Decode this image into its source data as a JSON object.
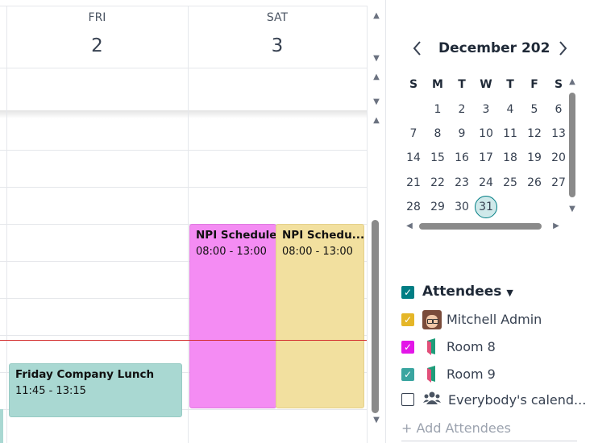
{
  "days": [
    {
      "dow": "FRI",
      "num": "2"
    },
    {
      "dow": "SAT",
      "num": "3"
    }
  ],
  "events": [
    {
      "title": "NPI Schedule S",
      "time": "08:00 - 13:00",
      "color": "#f48cf3"
    },
    {
      "title": "NPI Schedu...",
      "time": "08:00 - 13:00",
      "color": "#f2e09f"
    },
    {
      "title": "Friday Company Lunch",
      "time": "11:45 - 13:15",
      "color": "#a9d8d2"
    }
  ],
  "mini_calendar": {
    "month_label": "December 202",
    "prev_icon": "chevron-left-icon",
    "next_icon": "chevron-right-icon",
    "weekdays": [
      "S",
      "M",
      "T",
      "W",
      "T",
      "F",
      "S"
    ],
    "weeks": [
      [
        "",
        "1",
        "2",
        "3",
        "4",
        "5",
        "6"
      ],
      [
        "7",
        "8",
        "9",
        "10",
        "11",
        "12",
        "13"
      ],
      [
        "14",
        "15",
        "16",
        "17",
        "18",
        "19",
        "20"
      ],
      [
        "21",
        "22",
        "23",
        "24",
        "25",
        "26",
        "27"
      ],
      [
        "28",
        "29",
        "30",
        "31",
        "",
        "",
        ""
      ]
    ],
    "selected_day": "31"
  },
  "attendees": {
    "header": "Attendees",
    "items": [
      {
        "label": "Mitchell Admin",
        "color": "#e5b627",
        "checked": true,
        "icon": "avatar"
      },
      {
        "label": "Room 8",
        "color": "#e316e8",
        "checked": true,
        "icon": "room-icon"
      },
      {
        "label": "Room 9",
        "color": "#3aa5a0",
        "checked": true,
        "icon": "room-icon"
      },
      {
        "label": "Everybody's calend...",
        "color": "#ffffff",
        "checked": false,
        "icon": "people-icon"
      }
    ],
    "add_label": "+ Add Attendees"
  },
  "colors": {
    "accent": "#017e84",
    "current_time_line": "#d32f2f"
  }
}
